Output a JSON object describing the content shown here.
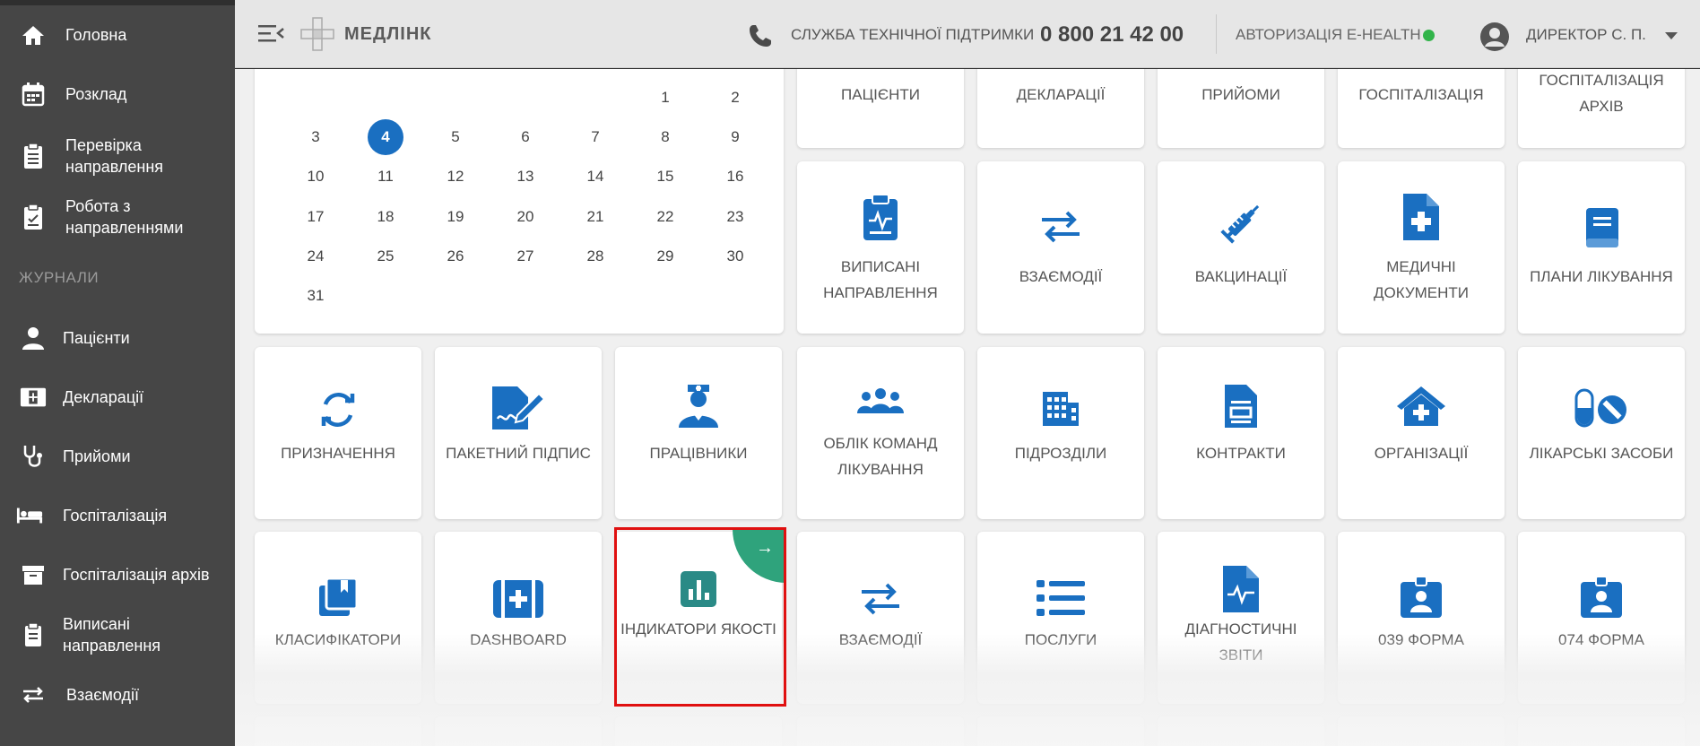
{
  "sidebar": {
    "items": [
      {
        "label": "Головна",
        "icon": "home-icon"
      },
      {
        "label": "Розклад",
        "icon": "calendar-icon"
      },
      {
        "label": "Перевірка направлення",
        "icon": "clipboard-check-icon"
      },
      {
        "label": "Робота з направленнями",
        "icon": "clipboard-list-icon"
      }
    ],
    "section_title": "ЖУРНАЛИ",
    "journal_items": [
      {
        "label": "Пацієнти",
        "icon": "person-icon"
      },
      {
        "label": "Декларації",
        "icon": "declaration-icon"
      },
      {
        "label": "Прийоми",
        "icon": "stethoscope-icon"
      },
      {
        "label": "Госпіталізація",
        "icon": "bed-icon"
      },
      {
        "label": "Госпіталізація архів",
        "icon": "archive-icon"
      },
      {
        "label": "Виписані направлення",
        "icon": "clipboard-icon"
      },
      {
        "label": "Взаємодії",
        "icon": "swap-icon"
      }
    ]
  },
  "header": {
    "logo": "МЕДЛІНК",
    "support_label": "СЛУЖБА ТЕХНІЧНОЇ ПІДТРИМКИ",
    "support_phone": "0 800 21 42 00",
    "ehealth_label": "АВТОРИЗАЦІЯ E-HEALTH",
    "ehealth_status_color": "#32b44a",
    "user": "ДИРЕКТОР С. П."
  },
  "calendar": {
    "selected_day": "4",
    "days": [
      "1",
      "2",
      "3",
      "4",
      "5",
      "6",
      "7",
      "8",
      "9",
      "10",
      "11",
      "12",
      "13",
      "14",
      "15",
      "16",
      "17",
      "18",
      "19",
      "20",
      "21",
      "22",
      "23",
      "24",
      "25",
      "26",
      "27",
      "28",
      "29",
      "30",
      "31"
    ]
  },
  "tiles": {
    "row0": [
      "ПАЦІЄНТИ",
      "ДЕКЛАРАЦІЇ",
      "ПРИЙОМИ",
      "ГОСПІТАЛІЗАЦІЯ",
      "ГОСПІТАЛІЗАЦІЯ АРХІВ"
    ],
    "row1": [
      "ВИПИСАНІ НАПРАВЛЕННЯ",
      "ВЗАЄМОДІЇ",
      "ВАКЦИНАЦІЇ",
      "МЕДИЧНІ ДОКУМЕНТИ",
      "ПЛАНИ ЛІКУВАННЯ"
    ],
    "row2": [
      "ПРИЗНАЧЕННЯ",
      "ПАКЕТНИЙ ПІДПИС",
      "ПРАЦІВНИКИ",
      "ОБЛІК КОМАНД ЛІКУВАННЯ",
      "ПІДРОЗДІЛИ",
      "КОНТРАКТИ",
      "ОРГАНІЗАЦІЇ",
      "ЛІКАРСЬКІ ЗАСОБИ"
    ],
    "row3": [
      "КЛАСИФІКАТОРИ",
      "DASHBOARD",
      "ІНДИКАТОРИ ЯКОСТІ",
      "ВЗАЄМОДІЇ",
      "ПОСЛУГИ",
      "ДІАГНОСТИЧНІ ЗВІТИ",
      "039 ФОРМА",
      "074 ФОРМА"
    ]
  },
  "colors": {
    "accent": "#1a6fc1",
    "teal": "#2a8a86",
    "highlight": "#e01010",
    "sidebar_bg": "#464646"
  }
}
